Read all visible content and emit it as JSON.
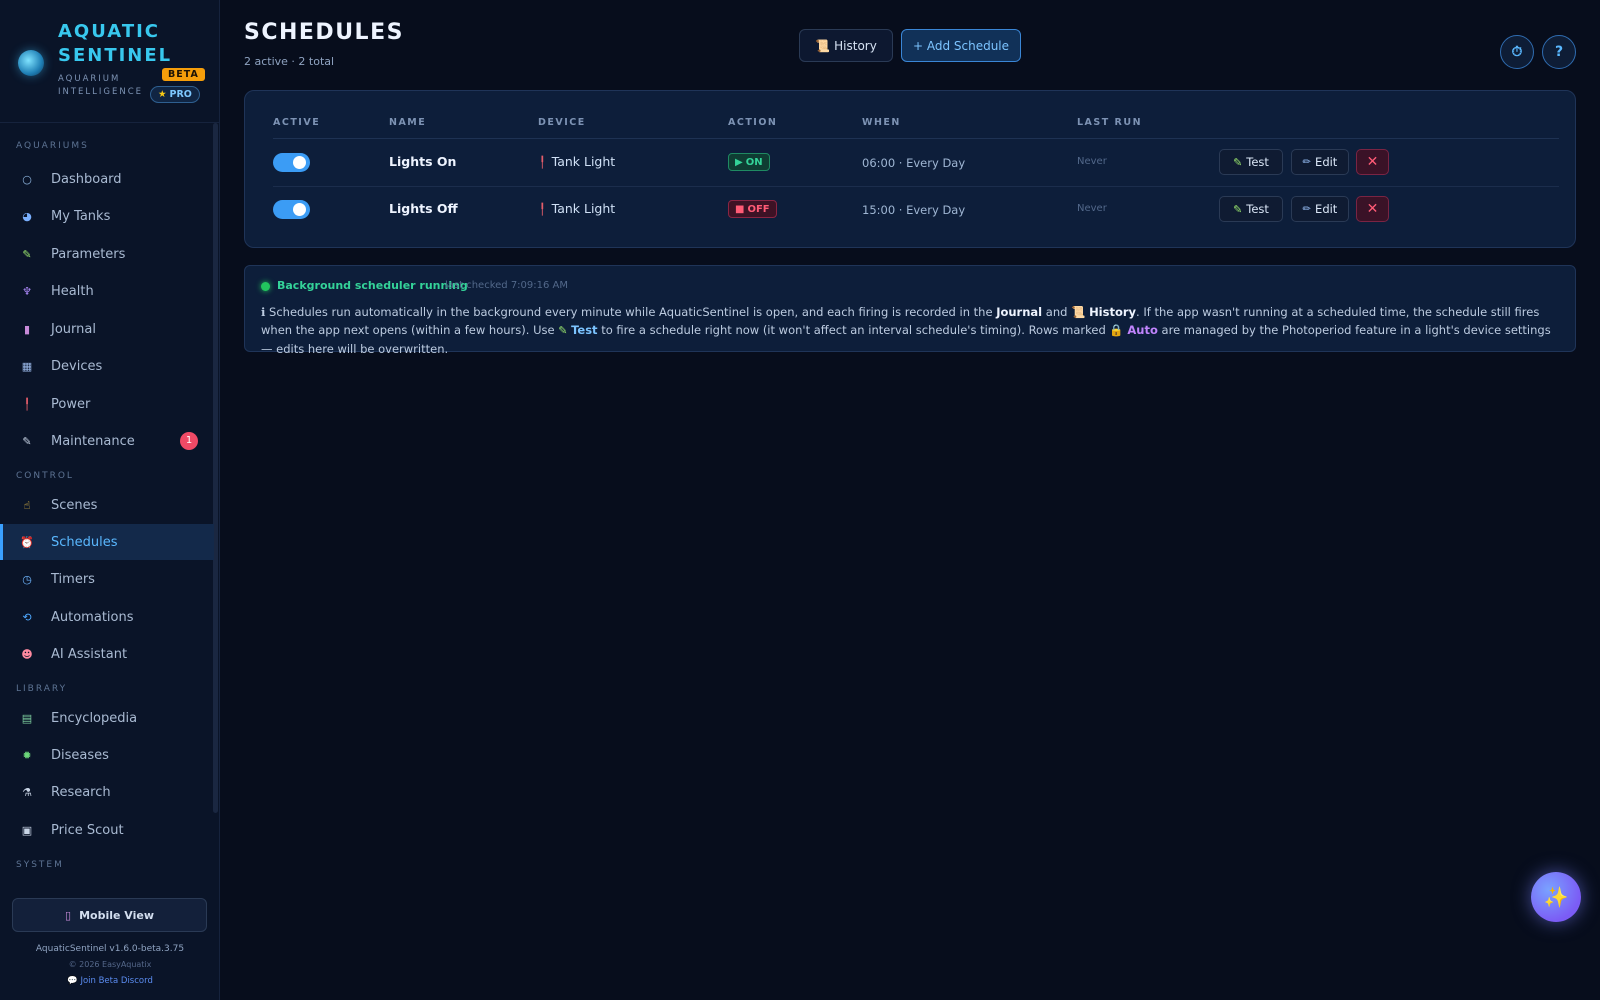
{
  "brand": {
    "name": "AQUATIC SENTINEL",
    "subtitle": "AQUARIUM INTELLIGENCE",
    "beta": "BETA",
    "pro": "PRO"
  },
  "nav": {
    "sections": {
      "aquariums": "AQUARIUMS",
      "control": "CONTROL",
      "library": "LIBRARY",
      "system": "SYSTEM"
    },
    "items": [
      {
        "label": "Dashboard",
        "icon": "circle-icon"
      },
      {
        "label": "My Tanks",
        "icon": "globe-icon"
      },
      {
        "label": "Parameters",
        "icon": "test-tube-icon"
      },
      {
        "label": "Health",
        "icon": "stethoscope-icon"
      },
      {
        "label": "Journal",
        "icon": "notebook-icon"
      },
      {
        "label": "Devices",
        "icon": "grid-icon"
      },
      {
        "label": "Power",
        "icon": "plug-icon"
      },
      {
        "label": "Maintenance",
        "icon": "wrench-icon",
        "badge": "1"
      },
      {
        "label": "Scenes",
        "icon": "hand-icon"
      },
      {
        "label": "Schedules",
        "icon": "alarm-clock-icon",
        "active": true
      },
      {
        "label": "Timers",
        "icon": "stopwatch-icon"
      },
      {
        "label": "Automations",
        "icon": "repeat-icon"
      },
      {
        "label": "AI Assistant",
        "icon": "robot-icon"
      },
      {
        "label": "Encyclopedia",
        "icon": "books-icon"
      },
      {
        "label": "Diseases",
        "icon": "microbe-icon"
      },
      {
        "label": "Research",
        "icon": "microscope-icon"
      },
      {
        "label": "Price Scout",
        "icon": "price-tag-icon"
      }
    ]
  },
  "footer": {
    "mobile_view": "Mobile View",
    "version": "AquaticSentinel v1.6.0-beta.3.75",
    "copyright": "© 2026 EasyAquatix",
    "discord": "Join Beta Discord"
  },
  "header": {
    "title": "SCHEDULES",
    "subtitle": "2 active · 2 total",
    "history_label": "History",
    "add_label": "+ Add Schedule"
  },
  "table": {
    "columns": [
      "ACTIVE",
      "NAME",
      "DEVICE",
      "ACTION",
      "WHEN",
      "LAST RUN"
    ],
    "rows": [
      {
        "active": true,
        "name": "Lights On",
        "device": "Tank Light",
        "action": "ON",
        "when": "06:00 · Every Day",
        "last_run": "Never"
      },
      {
        "active": true,
        "name": "Lights Off",
        "device": "Tank Light",
        "action": "OFF",
        "when": "15:00 · Every Day",
        "last_run": "Never"
      }
    ],
    "test_label": "Test",
    "edit_label": "Edit",
    "delete_label": "✕"
  },
  "status": {
    "text": "Background scheduler running",
    "checked": "last checked 7:09:16 AM",
    "info": {
      "part1": "Schedules run automatically in the background every minute while AquaticSentinel is open, and each firing is recorded in the",
      "journal": "Journal",
      "and": "and",
      "history": "History",
      "part2": ". If the app wasn't running at a scheduled time, the schedule still fires when the app next opens (within a few hours). Use",
      "test": "Test",
      "part3": "to fire a schedule right now (it won't affect an interval schedule's timing). Rows marked",
      "auto": "Auto",
      "part4": "are managed by the Photoperiod feature in a light's device settings — edits here will be overwritten."
    }
  },
  "colors": {
    "accent": "#3aa0ff",
    "on_green": "#34d399",
    "off_red": "#ff5b76",
    "brand_cyan": "#38c8ee"
  }
}
